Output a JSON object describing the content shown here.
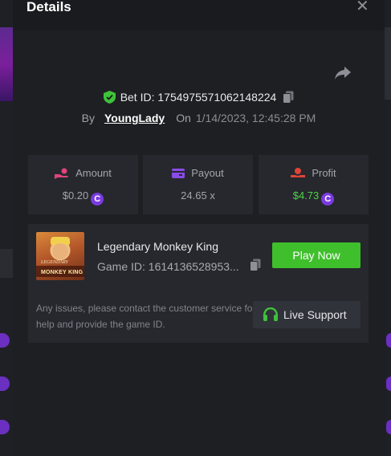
{
  "modal": {
    "title": "Details",
    "close_label": "✕"
  },
  "bet": {
    "id_label": "Bet ID:",
    "id_value": "1754975571062148224",
    "by_label": "By",
    "user": "YoungLady",
    "on_label": "On",
    "timestamp": "1/14/2023, 12:45:28 PM"
  },
  "stats": [
    {
      "label": "Amount",
      "value": "$0.20",
      "icon": "hand-coins-icon",
      "currency": "C"
    },
    {
      "label": "Payout",
      "value": "24.65 x",
      "icon": "wallet-icon"
    },
    {
      "label": "Profit",
      "value": "$4.73",
      "icon": "hand-profit-icon",
      "currency": "C"
    }
  ],
  "game": {
    "name": "Legendary Monkey King",
    "id_label": "Game ID:",
    "id_value": "1614136528953...",
    "thumb_text_small": "LEGENDARY",
    "thumb_text_main": "MONKEY KING",
    "play_label": "Play Now",
    "issues_text": "Any issues, please contact the customer service for help and provide the game ID.",
    "support_label": "Live Support"
  },
  "colors": {
    "accent_green": "#3fbf2c",
    "profit_green": "#4ed34a",
    "coin_purple": "#7a3be0",
    "amount_icon": "#e0447a",
    "payout_icon": "#8a4be8",
    "profit_icon": "#e0433a"
  }
}
